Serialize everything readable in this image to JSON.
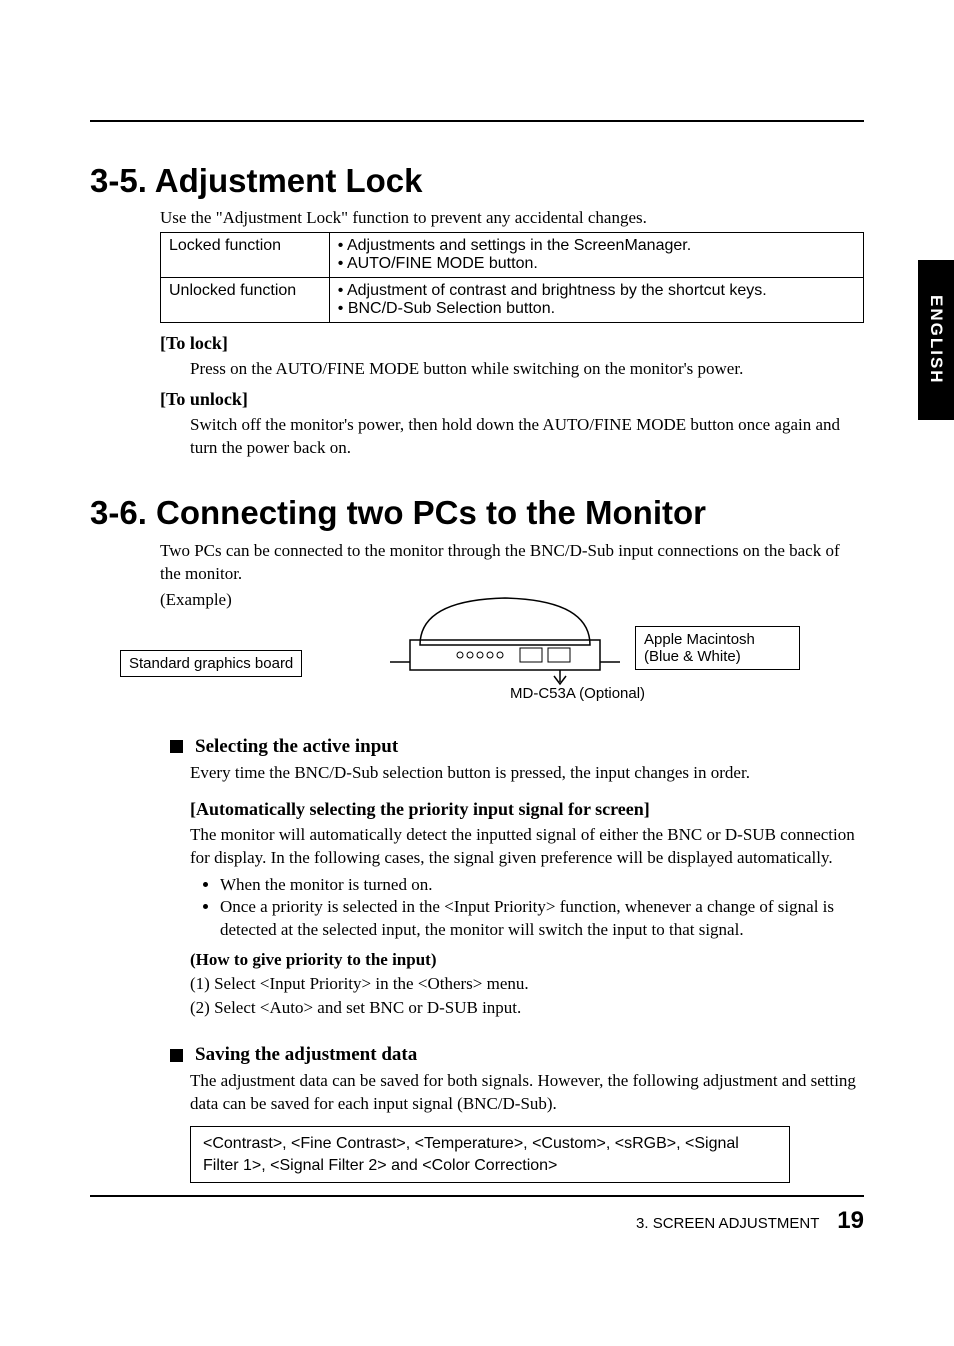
{
  "side_tab": "ENGLISH",
  "section35": {
    "title": "3-5. Adjustment Lock",
    "intro": "Use the \"Adjustment Lock\" function to prevent any accidental changes.",
    "table": {
      "r1_label": "Locked function",
      "r1_desc": "• Adjustments and settings in the ScreenManager.\n• AUTO/FINE MODE button.",
      "r2_label": "Unlocked function",
      "r2_desc": "• Adjustment of contrast and brightness by the shortcut keys.\n• BNC/D-Sub Selection button."
    },
    "to_lock_h": "[To lock]",
    "to_lock_p": "Press on the AUTO/FINE MODE button while switching on the monitor's power.",
    "to_unlock_h": "[To unlock]",
    "to_unlock_p": "Switch off the monitor's power, then hold down the AUTO/FINE MODE button once again and turn the power back on."
  },
  "section36": {
    "title": "3-6. Connecting two PCs to the Monitor",
    "intro": "Two PCs can be connected to the monitor through the BNC/D-Sub input connections on the back of the monitor.",
    "example": "(Example)",
    "diag_left": "Standard graphics board",
    "diag_right": "Apple Macintosh (Blue & White)",
    "diag_opt": "MD-C53A (Optional)",
    "sel_h": "Selecting the active input",
    "sel_p": "Every time the BNC/D-Sub selection button is pressed, the input changes in order.",
    "auto_h": "[Automatically selecting the priority input signal for screen]",
    "auto_p": "The monitor will automatically detect the inputted signal of either the BNC or D-SUB connection for display.  In the following cases, the signal given preference will be displayed automatically.",
    "li1": "When the monitor is turned on.",
    "li2": "Once a priority is selected in the <Input Priority> function, whenever a change of signal is detected at the selected input, the monitor will switch the input to that signal.",
    "howto": "(How to give priority to the input)",
    "step1": "(1) Select <Input Priority> in the <Others> menu.",
    "step2": "(2) Select <Auto> and set BNC or D-SUB input.",
    "save_h": "Saving the adjustment data",
    "save_p": "The adjustment data can be saved for both signals. However, the following adjustment and setting data can be saved for each input signal (BNC/D-Sub).",
    "save_box": "<Contrast>, <Fine Contrast>, <Temperature>, <Custom>, <sRGB>, <Signal Filter 1>, <Signal Filter 2> and <Color Correction>"
  },
  "footer": {
    "section": "3. SCREEN ADJUSTMENT",
    "page": "19"
  }
}
